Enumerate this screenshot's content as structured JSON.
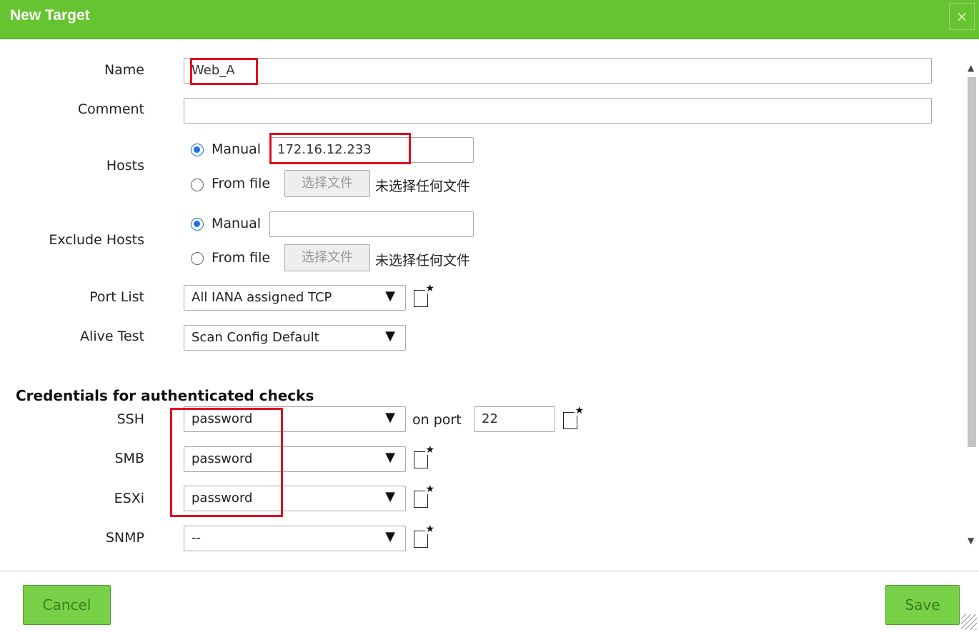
{
  "dialog": {
    "title": "New Target",
    "close": "×"
  },
  "fields": {
    "name": {
      "label": "Name",
      "value": "Web_A"
    },
    "comment": {
      "label": "Comment",
      "value": ""
    },
    "hosts": {
      "label": "Hosts",
      "manual_label": "Manual",
      "manual_value": "172.16.12.233",
      "from_file_label": "From file",
      "file_button": "选择文件",
      "no_file": "未选择任何文件",
      "selected": "manual"
    },
    "exclude_hosts": {
      "label": "Exclude Hosts",
      "manual_label": "Manual",
      "manual_value": "",
      "from_file_label": "From file",
      "file_button": "选择文件",
      "no_file": "未选择任何文件",
      "selected": "manual"
    },
    "port_list": {
      "label": "Port List",
      "value": "All IANA assigned TCP"
    },
    "alive_test": {
      "label": "Alive Test",
      "value": "Scan Config Default"
    }
  },
  "credentials": {
    "heading": "Credentials for authenticated checks",
    "ssh": {
      "label": "SSH",
      "value": "password",
      "on_port_label": "on port",
      "port": "22"
    },
    "smb": {
      "label": "SMB",
      "value": "password"
    },
    "esxi": {
      "label": "ESXi",
      "value": "password"
    },
    "snmp": {
      "label": "SNMP",
      "value": "--"
    }
  },
  "footer": {
    "cancel": "Cancel",
    "save": "Save"
  },
  "icons": {
    "dropdown": "▼",
    "new": "new-item-icon",
    "scroll_up": "▲",
    "scroll_down": "▼"
  },
  "colors": {
    "titlebar": "#66c430",
    "button": "#78d048",
    "highlight": "#e01020",
    "radio": "#1a73e8"
  }
}
